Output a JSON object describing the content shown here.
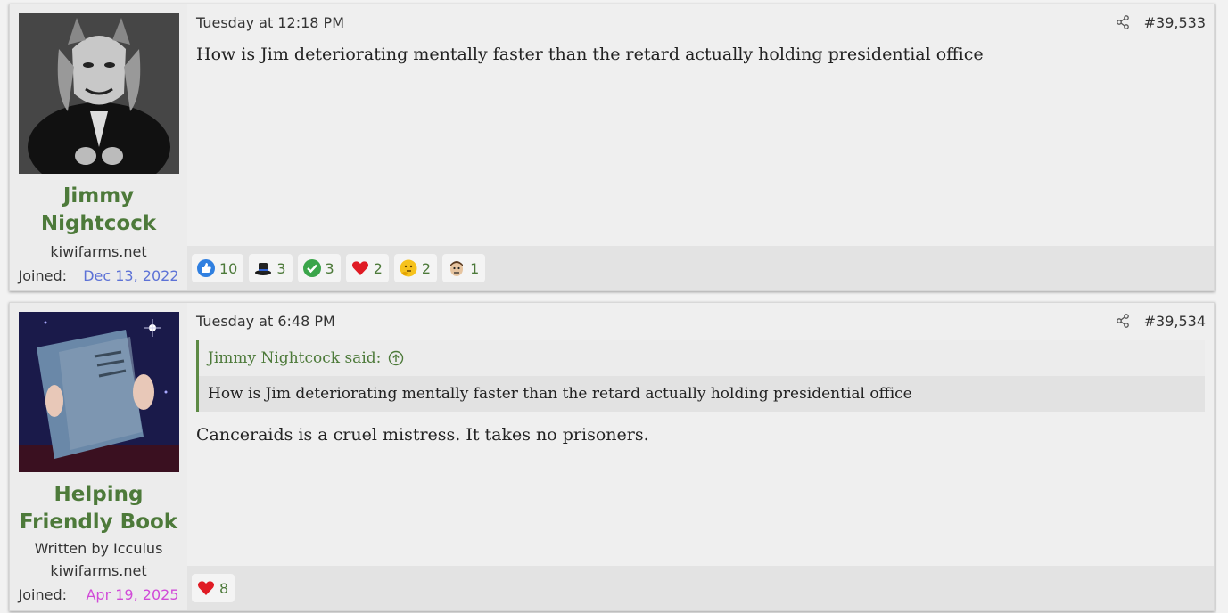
{
  "posts": [
    {
      "username": "Jimmy Nightcock",
      "domain": "kiwifarms.net",
      "joined_label": "Joined:",
      "joined_date": "Dec 13, 2022",
      "timestamp": "Tuesday at 12:18 PM",
      "post_number": "#39,533",
      "body": "How is Jim deteriorating mentally faster than the retard actually holding presidential office",
      "reactions": [
        {
          "icon": "thumbs-up-icon",
          "count": "10"
        },
        {
          "icon": "top-hat-icon",
          "count": "3"
        },
        {
          "icon": "check-icon",
          "count": "3"
        },
        {
          "icon": "heart-icon",
          "count": "2"
        },
        {
          "icon": "thinking-face-icon",
          "count": "2"
        },
        {
          "icon": "face-icon",
          "count": "1"
        }
      ]
    },
    {
      "username": "Helping Friendly Book",
      "user_title": "Written by Icculus",
      "domain": "kiwifarms.net",
      "joined_label": "Joined:",
      "joined_date": "Apr 19, 2025",
      "timestamp": "Tuesday at 6:48 PM",
      "post_number": "#39,534",
      "quote_author": "Jimmy Nightcock said:",
      "quote_body": "How is Jim deteriorating mentally faster than the retard actually holding presidential office",
      "body": "Canceraids is a cruel mistress. It takes no prisoners.",
      "reactions": [
        {
          "icon": "heart-icon",
          "count": "8"
        }
      ]
    }
  ],
  "colors": {
    "username": "#4d7a3a",
    "joined_date_1": "#5d72d6",
    "joined_date_2": "#d14ad8",
    "quote_border": "#5d8a45"
  }
}
